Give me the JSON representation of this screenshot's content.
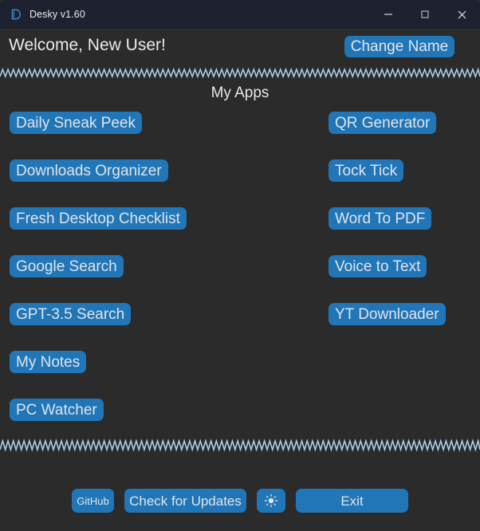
{
  "window": {
    "title": "Desky v1.60",
    "logo_icon": "app-d-logo-icon",
    "controls": {
      "minimize": "minimize-icon",
      "maximize": "maximize-icon",
      "close": "close-icon"
    }
  },
  "header": {
    "welcome_text": "Welcome, New User!",
    "change_name_label": "Change Name"
  },
  "apps": {
    "heading": "My Apps",
    "left_column": [
      {
        "label": "Daily Sneak Peek"
      },
      {
        "label": "Downloads Organizer"
      },
      {
        "label": "Fresh Desktop Checklist"
      },
      {
        "label": "Google Search"
      },
      {
        "label": "GPT-3.5 Search"
      },
      {
        "label": "My Notes"
      },
      {
        "label": "PC Watcher"
      }
    ],
    "right_column": [
      {
        "label": "QR Generator"
      },
      {
        "label": "Tock Tick"
      },
      {
        "label": "Word To PDF"
      },
      {
        "label": "Voice to Text"
      },
      {
        "label": "YT Downloader"
      }
    ]
  },
  "footer": {
    "github_label": "GitHub",
    "check_updates_label": "Check for Updates",
    "theme_toggle_icon": "sun-brightness-icon",
    "exit_label": "Exit"
  },
  "colors": {
    "window_background": "#2b2b2b",
    "title_bar": "#1e2230",
    "accent_blue": "#2176b8",
    "text_primary": "#e3e6ea",
    "zigzag": "#9ec8ea"
  }
}
